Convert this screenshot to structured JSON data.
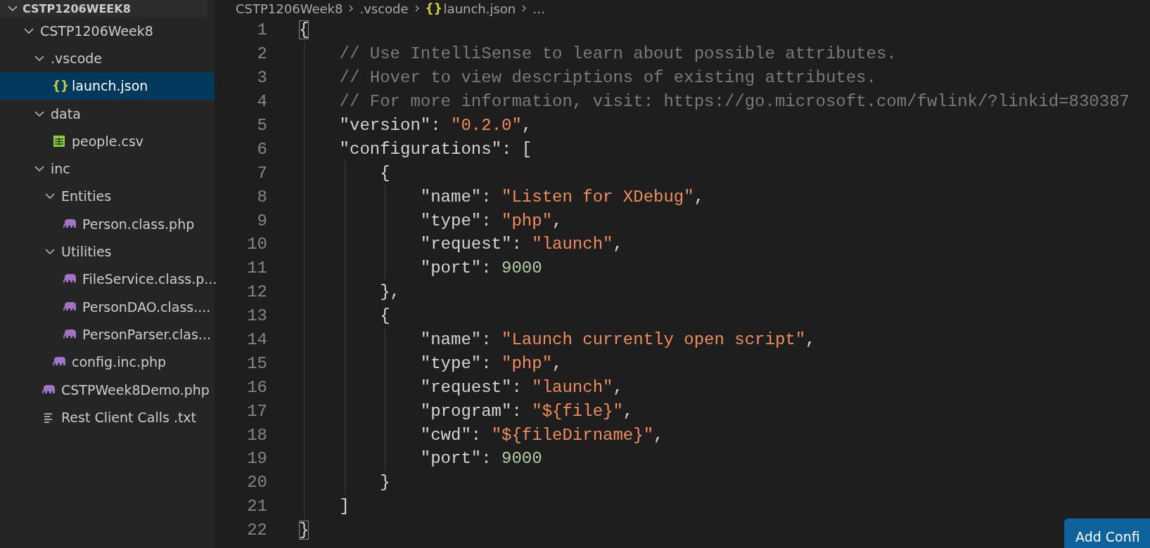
{
  "sidebar": {
    "section_title": "CSTP1206WEEK8",
    "tree": [
      {
        "label": "CSTP1206Week8",
        "kind": "folder",
        "expanded": true,
        "selected": false,
        "children": [
          {
            "label": ".vscode",
            "kind": "folder",
            "expanded": true,
            "selected": false,
            "children": [
              {
                "label": "launch.json",
                "kind": "json-file",
                "icon_text": "{}",
                "selected": true
              }
            ]
          },
          {
            "label": "data",
            "kind": "folder",
            "expanded": true,
            "selected": false,
            "children": [
              {
                "label": "people.csv",
                "kind": "csv-file",
                "selected": false
              }
            ]
          },
          {
            "label": "inc",
            "kind": "folder",
            "expanded": true,
            "selected": false,
            "children": [
              {
                "label": "Entities",
                "kind": "folder",
                "expanded": true,
                "selected": false,
                "children": [
                  {
                    "label": "Person.class.php",
                    "kind": "php-file",
                    "selected": false
                  }
                ]
              },
              {
                "label": "Utilities",
                "kind": "folder",
                "expanded": true,
                "selected": false,
                "children": [
                  {
                    "label": "FileService.class.p...",
                    "kind": "php-file",
                    "selected": false
                  },
                  {
                    "label": "PersonDAO.class....",
                    "kind": "php-file",
                    "selected": false
                  },
                  {
                    "label": "PersonParser.clas...",
                    "kind": "php-file",
                    "selected": false
                  }
                ]
              },
              {
                "label": "config.inc.php",
                "kind": "php-file",
                "selected": false
              }
            ]
          },
          {
            "label": "CSTPWeek8Demo.php",
            "kind": "php-file",
            "selected": false
          },
          {
            "label": "Rest Client Calls .txt",
            "kind": "text-file",
            "selected": false
          }
        ]
      }
    ]
  },
  "breadcrumb": [
    {
      "label": "CSTP1206Week8"
    },
    {
      "label": ".vscode"
    },
    {
      "label": "launch.json",
      "icon_text": "{}"
    },
    {
      "label": "…"
    }
  ],
  "editor": {
    "lines": [
      {
        "number": "1",
        "tokens": [
          {
            "kind": "bracket",
            "text": "{",
            "highlighted": true
          }
        ],
        "children": [
          {
            "number": "2",
            "tokens": [
              {
                "kind": "comment",
                "text": "// Use IntelliSense to learn about possible attributes."
              }
            ]
          },
          {
            "number": "3",
            "tokens": [
              {
                "kind": "comment",
                "text": "// Hover to view descriptions of existing attributes."
              }
            ]
          },
          {
            "number": "4",
            "tokens": [
              {
                "kind": "comment",
                "text": "// For more information, visit: https://go.microsoft.com/fwlink/?linkid=830387"
              }
            ]
          },
          {
            "number": "5",
            "tokens": [
              {
                "kind": "key",
                "text": "\"version\""
              },
              {
                "kind": "punct",
                "text": ": "
              },
              {
                "kind": "string",
                "text": "\"0.2.0\""
              },
              {
                "kind": "punct",
                "text": ","
              }
            ]
          },
          {
            "number": "6",
            "tokens": [
              {
                "kind": "key",
                "text": "\"configurations\""
              },
              {
                "kind": "punct",
                "text": ": ["
              }
            ],
            "children": [
              {
                "number": "7",
                "tokens": [
                  {
                    "kind": "punct",
                    "text": "{"
                  }
                ],
                "children": [
                  {
                    "number": "8",
                    "tokens": [
                      {
                        "kind": "key",
                        "text": "\"name\""
                      },
                      {
                        "kind": "punct",
                        "text": ": "
                      },
                      {
                        "kind": "string",
                        "text": "\"Listen for XDebug\""
                      },
                      {
                        "kind": "punct",
                        "text": ","
                      }
                    ]
                  },
                  {
                    "number": "9",
                    "tokens": [
                      {
                        "kind": "key",
                        "text": "\"type\""
                      },
                      {
                        "kind": "punct",
                        "text": ": "
                      },
                      {
                        "kind": "string",
                        "text": "\"php\""
                      },
                      {
                        "kind": "punct",
                        "text": ","
                      }
                    ]
                  },
                  {
                    "number": "10",
                    "tokens": [
                      {
                        "kind": "key",
                        "text": "\"request\""
                      },
                      {
                        "kind": "punct",
                        "text": ": "
                      },
                      {
                        "kind": "string",
                        "text": "\"launch\""
                      },
                      {
                        "kind": "punct",
                        "text": ","
                      }
                    ]
                  },
                  {
                    "number": "11",
                    "tokens": [
                      {
                        "kind": "key",
                        "text": "\"port\""
                      },
                      {
                        "kind": "punct",
                        "text": ": "
                      },
                      {
                        "kind": "number",
                        "text": "9000"
                      }
                    ]
                  }
                ]
              },
              {
                "number": "12",
                "tokens": [
                  {
                    "kind": "punct",
                    "text": "},"
                  }
                ]
              },
              {
                "number": "13",
                "tokens": [
                  {
                    "kind": "punct",
                    "text": "{"
                  }
                ],
                "children": [
                  {
                    "number": "14",
                    "tokens": [
                      {
                        "kind": "key",
                        "text": "\"name\""
                      },
                      {
                        "kind": "punct",
                        "text": ": "
                      },
                      {
                        "kind": "string",
                        "text": "\"Launch currently open script\""
                      },
                      {
                        "kind": "punct",
                        "text": ","
                      }
                    ]
                  },
                  {
                    "number": "15",
                    "tokens": [
                      {
                        "kind": "key",
                        "text": "\"type\""
                      },
                      {
                        "kind": "punct",
                        "text": ": "
                      },
                      {
                        "kind": "string",
                        "text": "\"php\""
                      },
                      {
                        "kind": "punct",
                        "text": ","
                      }
                    ]
                  },
                  {
                    "number": "16",
                    "tokens": [
                      {
                        "kind": "key",
                        "text": "\"request\""
                      },
                      {
                        "kind": "punct",
                        "text": ": "
                      },
                      {
                        "kind": "string",
                        "text": "\"launch\""
                      },
                      {
                        "kind": "punct",
                        "text": ","
                      }
                    ]
                  },
                  {
                    "number": "17",
                    "tokens": [
                      {
                        "kind": "key",
                        "text": "\"program\""
                      },
                      {
                        "kind": "punct",
                        "text": ": "
                      },
                      {
                        "kind": "string",
                        "text": "\"${file}\""
                      },
                      {
                        "kind": "punct",
                        "text": ","
                      }
                    ]
                  },
                  {
                    "number": "18",
                    "tokens": [
                      {
                        "kind": "key",
                        "text": "\"cwd\""
                      },
                      {
                        "kind": "punct",
                        "text": ": "
                      },
                      {
                        "kind": "string",
                        "text": "\"${fileDirname}\""
                      },
                      {
                        "kind": "punct",
                        "text": ","
                      }
                    ]
                  },
                  {
                    "number": "19",
                    "tokens": [
                      {
                        "kind": "key",
                        "text": "\"port\""
                      },
                      {
                        "kind": "punct",
                        "text": ": "
                      },
                      {
                        "kind": "number",
                        "text": "9000"
                      }
                    ]
                  }
                ]
              },
              {
                "number": "20",
                "tokens": [
                  {
                    "kind": "punct",
                    "text": "}"
                  }
                ]
              }
            ]
          },
          {
            "number": "21",
            "tokens": [
              {
                "kind": "punct",
                "text": "]"
              }
            ]
          }
        ]
      },
      {
        "number": "22",
        "tokens": [
          {
            "kind": "bracket",
            "text": "}",
            "highlighted": true
          }
        ]
      }
    ]
  },
  "add_button": {
    "label": "Add Confi"
  }
}
